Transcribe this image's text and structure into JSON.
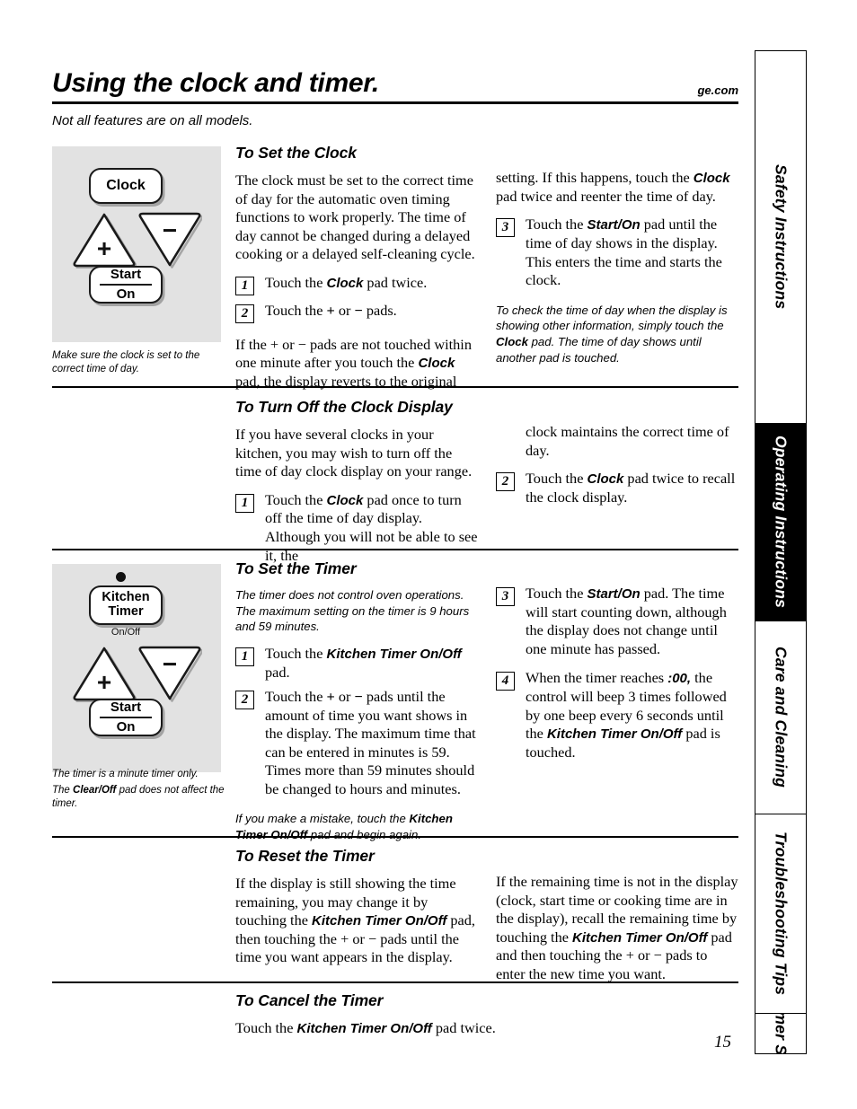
{
  "header": {
    "title": "Using the clock and timer.",
    "website": "ge.com",
    "subtitle": "Not all features are on all models."
  },
  "side_tabs": [
    {
      "label": "Safety Instructions",
      "active": false
    },
    {
      "label": "Operating Instructions",
      "active": true
    },
    {
      "label": "Care and Cleaning",
      "active": false
    },
    {
      "label": "Troubleshooting Tips",
      "active": false
    },
    {
      "label": "Consumer Support",
      "active": false
    }
  ],
  "illustrations": {
    "clock_panel": {
      "clock_pad": "Clock",
      "plus_symbol": "+",
      "minus_symbol": "−",
      "start_line1": "Start",
      "start_line2": "On",
      "caption": "Make sure the clock is set to the correct time of day."
    },
    "timer_panel": {
      "kitchen_line1": "Kitchen",
      "kitchen_line2": "Timer",
      "onoff_label": "On/Off",
      "plus_symbol": "+",
      "minus_symbol": "−",
      "start_line1": "Start",
      "start_line2": "On",
      "caption_line1": "The timer is a minute timer only.",
      "caption_line2_pre": "The ",
      "caption_line2_bold": "Clear/Off",
      "caption_line2_post": " pad does not affect the timer."
    }
  },
  "sections": {
    "set_clock": {
      "heading": "To Set the Clock",
      "intro": "The clock must be set to the correct time of day for the automatic oven timing functions to work properly. The time of day cannot be changed during a delayed cooking or a delayed self-cleaning cycle.",
      "step1_num": "1",
      "step1_pre": "Touch the ",
      "step1_bold": "Clock",
      "step1_post": " pad twice.",
      "step2_num": "2",
      "step2_pre": "Touch the ",
      "step2_sym1": "+",
      "step2_mid": " or ",
      "step2_sym2": "−",
      "step2_post": " pads.",
      "para_left_pre": "If the ",
      "para_left_sym1": "+",
      "para_left_mid": " or ",
      "para_left_sym2": "−",
      "para_left_post": " pads are not touched within one minute after you touch the ",
      "para_left_bold": "Clock",
      "para_left_end": " pad, the display reverts to the original",
      "para_right_pre": "setting. If this happens, touch the ",
      "para_right_bold": "Clock",
      "para_right_post": " pad twice and reenter the time of day.",
      "step3_num": "3",
      "step3_pre": "Touch the ",
      "step3_bold": "Start/On",
      "step3_post": " pad until the time of day shows in the display. This enters the time and starts the clock.",
      "note_pre": "To check the time of day when the display is showing other information, simply touch the ",
      "note_bold": "Clock",
      "note_post": " pad. The time of day shows until another pad is touched."
    },
    "turn_off_clock": {
      "heading": "To Turn Off the Clock Display",
      "intro": "If you have several clocks in your kitchen, you may wish to turn off the time of day clock display on your range.",
      "step1_num": "1",
      "step1_pre": "Touch the ",
      "step1_bold": "Clock",
      "step1_post": " pad once to turn off the time of day display. Although you will not be able to see it, the",
      "step1_cont": "clock maintains the correct time of day.",
      "step2_num": "2",
      "step2_pre": "Touch the ",
      "step2_bold": "Clock",
      "step2_post": " pad twice to recall the clock display."
    },
    "set_timer": {
      "heading": "To Set the Timer",
      "note_top": "The timer does not control oven operations. The maximum setting on the timer is 9 hours and 59 minutes.",
      "step1_num": "1",
      "step1_pre": "Touch the ",
      "step1_bold": "Kitchen Timer On/Off",
      "step1_post": " pad.",
      "step2_num": "2",
      "step2_pre": "Touch the ",
      "step2_sym1": "+",
      "step2_mid": " or ",
      "step2_sym2": "−",
      "step2_post": " pads until the amount of time you want shows in the display. The maximum time that can be entered in minutes is 59. Times more than 59 minutes should be changed to hours and minutes.",
      "note_bottom_pre": "If you make a mistake, touch the ",
      "note_bottom_bold": "Kitchen Timer On/Off",
      "note_bottom_post": " pad and begin again.",
      "step3_num": "3",
      "step3_pre": "Touch the ",
      "step3_bold": "Start/On",
      "step3_post": " pad. The time will start counting down, although the display does not change until one minute has passed.",
      "step4_num": "4",
      "step4_pre": "When the timer reaches ",
      "step4_bold1": ":00,",
      "step4_mid": " the control will beep 3 times followed by one beep every 6 seconds until the ",
      "step4_bold2": "Kitchen Timer On/Off",
      "step4_post": " pad is touched."
    },
    "reset_timer": {
      "heading": "To Reset the Timer",
      "left_pre": "If the display is still showing the time remaining, you may change it by touching the ",
      "left_bold": "Kitchen Timer On/Off",
      "left_mid": " pad, then touching the ",
      "left_sym1": "+",
      "left_or": " or ",
      "left_sym2": "−",
      "left_post": " pads until the time you want appears in the display.",
      "right_pre": "If the remaining time is not in the display (clock, start time or cooking time are in the display), recall the remaining time by touching the ",
      "right_bold": "Kitchen Timer On/Off",
      "right_mid": " pad and then touching the ",
      "right_sym1": "+",
      "right_or": " or ",
      "right_sym2": "−",
      "right_post": " pads to enter the new time you want."
    },
    "cancel_timer": {
      "heading": "To Cancel the Timer",
      "body_pre": "Touch the ",
      "body_bold": "Kitchen Timer On/Off",
      "body_post": " pad twice."
    }
  },
  "page_number": "15",
  "colors": {
    "panel_background": "#e2e2e2",
    "ink": "#000000",
    "active_tab_background": "#000000",
    "active_tab_text": "#ffffff"
  }
}
